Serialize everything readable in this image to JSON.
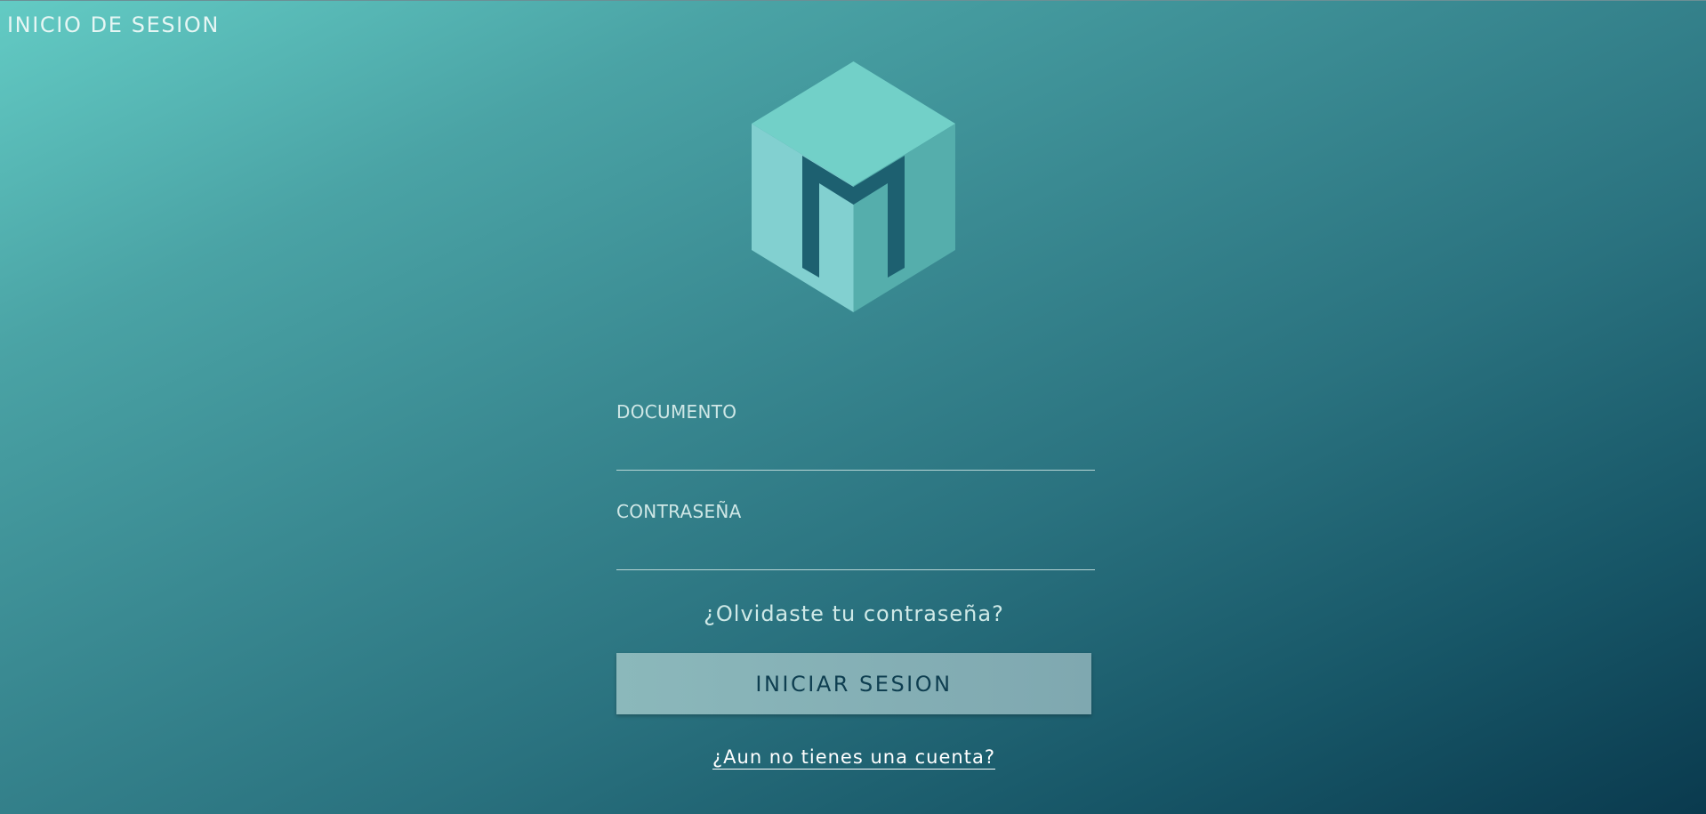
{
  "header": {
    "title": "INICIO DE SESION"
  },
  "logo": {
    "name": "cube-m-logo",
    "colors": {
      "top": "#72d0c8",
      "left": "#82d0d0",
      "right": "#55aeac",
      "letter": "#1d6070"
    }
  },
  "form": {
    "document_label": "DOCUMENTO",
    "document_value": "",
    "password_label": "CONTRASEÑA",
    "password_value": "",
    "forgot_link": "¿Olvidaste tu contraseña?",
    "submit_label": "INICIAR SESION",
    "signup_link": "¿Aun no tienes una cuenta?"
  },
  "colors": {
    "background_start": "#63cbc4",
    "background_end": "#0a3a4e",
    "button_bg": "#85b2b6",
    "button_text": "#0e3e50"
  }
}
